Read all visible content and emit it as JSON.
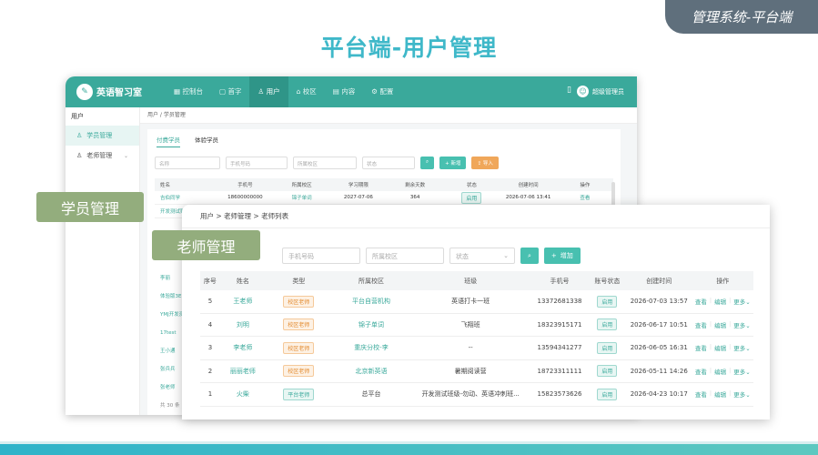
{
  "slide": {
    "corner_tag": "管理系统-平台端",
    "title": "平台端-用户管理",
    "callout_students": "学员管理",
    "callout_teachers": "老师管理"
  },
  "back_window": {
    "brand": "英语智习室",
    "brand_sub": "英语智习室",
    "nav": [
      "控制台",
      "首字",
      "用户",
      "校区",
      "内容",
      "配置"
    ],
    "active_nav": "用户",
    "user_name": "超级管理员",
    "sidebar_head": "用户",
    "sidebar_items": [
      {
        "label": "学员管理",
        "active": true
      },
      {
        "label": "老师管理",
        "active": false
      }
    ],
    "breadcrumb": "用户 / 学员管理",
    "tabs": [
      "付费学员",
      "体验学员"
    ],
    "filters": {
      "name_ph": "名称",
      "phone_ph": "手机号码",
      "campus_ph": "所属校区",
      "status_ph": "状态",
      "add_label": "新增",
      "import_label": "导入"
    },
    "columns": [
      "姓名",
      "手机号",
      "所属校区",
      "学习期限",
      "剩余天数",
      "状态",
      "创建时间",
      "操作"
    ],
    "rows": [
      [
        "吉伯同学",
        "18600000000",
        "锦子单词",
        "2027-07-06",
        "364",
        "启用",
        "2026-07-06 13:41",
        "查看"
      ],
      [
        "开发测试账号",
        "",
        "",
        "",
        "",
        "",
        "",
        ""
      ]
    ],
    "extra_names": [
      "李丽",
      "体验版3E",
      "YMJ开发测",
      "17test",
      "王小通",
      "张兵兵",
      "张老师"
    ],
    "footer": "共 30 条"
  },
  "front_window": {
    "breadcrumb": "用户 > 老师管理 > 老师列表",
    "filters": {
      "phone_ph": "手机号码",
      "campus_ph": "所属校区",
      "status_ph": "状态",
      "add_label": "增加"
    },
    "columns": [
      "序号",
      "姓名",
      "类型",
      "所属校区",
      "班级",
      "手机号",
      "账号状态",
      "创建时间",
      "操作"
    ],
    "rows": [
      {
        "no": "5",
        "name": "王老师",
        "type": "校区老师",
        "campus": "平台自营机构",
        "class": "英语打卡一班",
        "phone": "13372681338",
        "status": "启用",
        "created": "2026-07-03 13:57"
      },
      {
        "no": "4",
        "name": "刘明",
        "type": "校区老师",
        "campus": "锦子单词",
        "class": "飞翔班",
        "phone": "18323915171",
        "status": "启用",
        "created": "2026-06-17 10:51"
      },
      {
        "no": "3",
        "name": "李老师",
        "type": "校区老师",
        "campus": "重庆分校-李",
        "class": "--",
        "phone": "13594341277",
        "status": "启用",
        "created": "2026-06-05 16:31"
      },
      {
        "no": "2",
        "name": "丽丽老师",
        "type": "校区老师",
        "campus": "北京新英语",
        "class": "暑期阅读营",
        "phone": "18723311111",
        "status": "启用",
        "created": "2026-05-11 14:26"
      },
      {
        "no": "1",
        "name": "火柴",
        "type": "平台老师",
        "campus": "总平台",
        "class": "开发测试班级-勿动、英语冲刺班...",
        "phone": "15823573626",
        "status": "启用",
        "created": "2026-04-23 10:17"
      }
    ],
    "ops": {
      "view": "查看",
      "edit": "编辑",
      "more": "更多"
    }
  }
}
